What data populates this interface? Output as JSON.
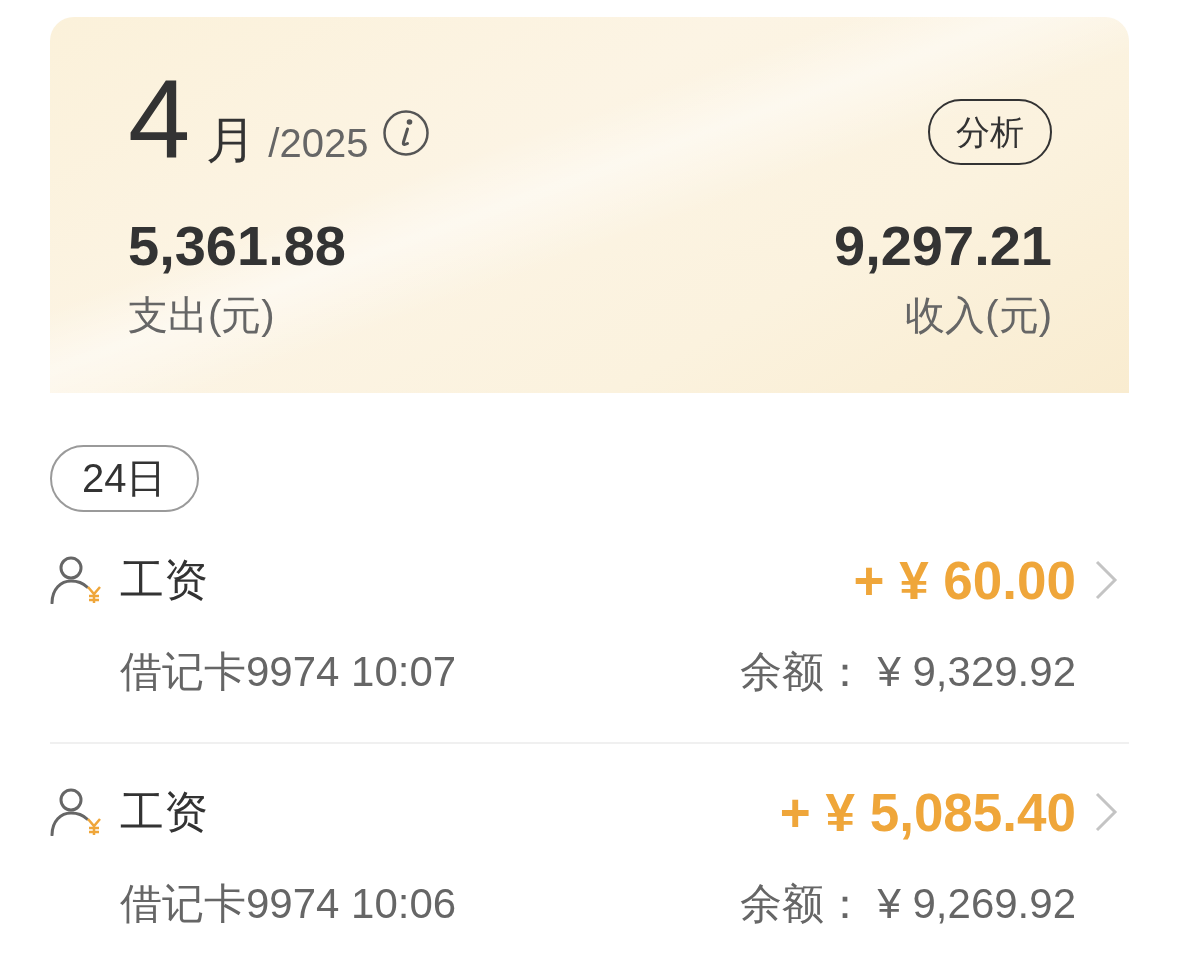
{
  "summary": {
    "month": "4",
    "month_unit": "月",
    "year": "/2025",
    "analysis_button": "分析",
    "expense": {
      "amount": "5,361.88",
      "label": "支出(元)"
    },
    "income": {
      "amount": "9,297.21",
      "label": "收入(元)"
    }
  },
  "days": [
    {
      "date": "24日",
      "transactions": [
        {
          "kind": "income",
          "category": "工资",
          "amount": "+ ¥ 60.00",
          "account_time": "借记卡9974 10:07",
          "balance": "余额： ¥ 9,329.92"
        },
        {
          "kind": "income",
          "category": "工资",
          "amount": "+ ¥ 5,085.40",
          "account_time": "借记卡9974 10:06",
          "balance": "余额： ¥ 9,269.92"
        }
      ]
    }
  ]
}
